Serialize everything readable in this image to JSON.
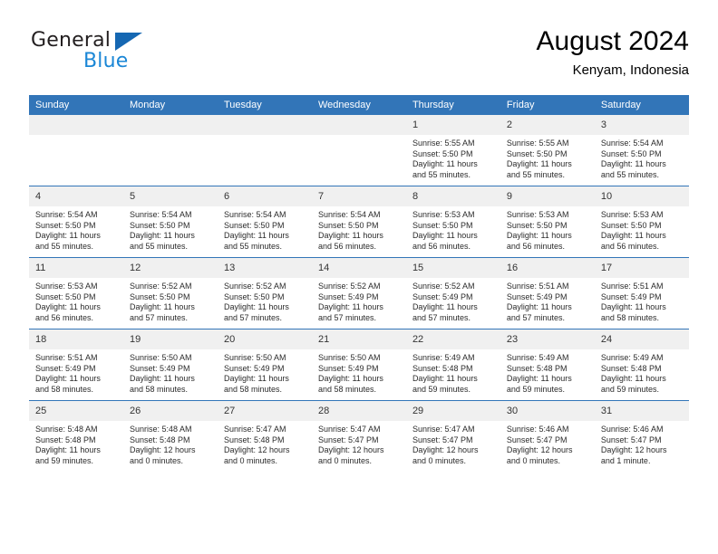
{
  "brand": {
    "word1": "General",
    "word2": "Blue",
    "triangle_color": "#1567b2",
    "blue_color": "#1b87d6"
  },
  "header": {
    "title": "August 2024",
    "subtitle": "Kenyam, Indonesia"
  },
  "theme": {
    "header_blue": "#3275b8",
    "daynum_band": "#f0f0f0"
  },
  "weekdays": [
    "Sunday",
    "Monday",
    "Tuesday",
    "Wednesday",
    "Thursday",
    "Friday",
    "Saturday"
  ],
  "weeks": [
    [
      {
        "day": "",
        "empty": true
      },
      {
        "day": "",
        "empty": true
      },
      {
        "day": "",
        "empty": true
      },
      {
        "day": "",
        "empty": true
      },
      {
        "day": "1",
        "sunrise": "Sunrise: 5:55 AM",
        "sunset": "Sunset: 5:50 PM",
        "daylight1": "Daylight: 11 hours",
        "daylight2": "and 55 minutes."
      },
      {
        "day": "2",
        "sunrise": "Sunrise: 5:55 AM",
        "sunset": "Sunset: 5:50 PM",
        "daylight1": "Daylight: 11 hours",
        "daylight2": "and 55 minutes."
      },
      {
        "day": "3",
        "sunrise": "Sunrise: 5:54 AM",
        "sunset": "Sunset: 5:50 PM",
        "daylight1": "Daylight: 11 hours",
        "daylight2": "and 55 minutes."
      }
    ],
    [
      {
        "day": "4",
        "sunrise": "Sunrise: 5:54 AM",
        "sunset": "Sunset: 5:50 PM",
        "daylight1": "Daylight: 11 hours",
        "daylight2": "and 55 minutes."
      },
      {
        "day": "5",
        "sunrise": "Sunrise: 5:54 AM",
        "sunset": "Sunset: 5:50 PM",
        "daylight1": "Daylight: 11 hours",
        "daylight2": "and 55 minutes."
      },
      {
        "day": "6",
        "sunrise": "Sunrise: 5:54 AM",
        "sunset": "Sunset: 5:50 PM",
        "daylight1": "Daylight: 11 hours",
        "daylight2": "and 55 minutes."
      },
      {
        "day": "7",
        "sunrise": "Sunrise: 5:54 AM",
        "sunset": "Sunset: 5:50 PM",
        "daylight1": "Daylight: 11 hours",
        "daylight2": "and 56 minutes."
      },
      {
        "day": "8",
        "sunrise": "Sunrise: 5:53 AM",
        "sunset": "Sunset: 5:50 PM",
        "daylight1": "Daylight: 11 hours",
        "daylight2": "and 56 minutes."
      },
      {
        "day": "9",
        "sunrise": "Sunrise: 5:53 AM",
        "sunset": "Sunset: 5:50 PM",
        "daylight1": "Daylight: 11 hours",
        "daylight2": "and 56 minutes."
      },
      {
        "day": "10",
        "sunrise": "Sunrise: 5:53 AM",
        "sunset": "Sunset: 5:50 PM",
        "daylight1": "Daylight: 11 hours",
        "daylight2": "and 56 minutes."
      }
    ],
    [
      {
        "day": "11",
        "sunrise": "Sunrise: 5:53 AM",
        "sunset": "Sunset: 5:50 PM",
        "daylight1": "Daylight: 11 hours",
        "daylight2": "and 56 minutes."
      },
      {
        "day": "12",
        "sunrise": "Sunrise: 5:52 AM",
        "sunset": "Sunset: 5:50 PM",
        "daylight1": "Daylight: 11 hours",
        "daylight2": "and 57 minutes."
      },
      {
        "day": "13",
        "sunrise": "Sunrise: 5:52 AM",
        "sunset": "Sunset: 5:50 PM",
        "daylight1": "Daylight: 11 hours",
        "daylight2": "and 57 minutes."
      },
      {
        "day": "14",
        "sunrise": "Sunrise: 5:52 AM",
        "sunset": "Sunset: 5:49 PM",
        "daylight1": "Daylight: 11 hours",
        "daylight2": "and 57 minutes."
      },
      {
        "day": "15",
        "sunrise": "Sunrise: 5:52 AM",
        "sunset": "Sunset: 5:49 PM",
        "daylight1": "Daylight: 11 hours",
        "daylight2": "and 57 minutes."
      },
      {
        "day": "16",
        "sunrise": "Sunrise: 5:51 AM",
        "sunset": "Sunset: 5:49 PM",
        "daylight1": "Daylight: 11 hours",
        "daylight2": "and 57 minutes."
      },
      {
        "day": "17",
        "sunrise": "Sunrise: 5:51 AM",
        "sunset": "Sunset: 5:49 PM",
        "daylight1": "Daylight: 11 hours",
        "daylight2": "and 58 minutes."
      }
    ],
    [
      {
        "day": "18",
        "sunrise": "Sunrise: 5:51 AM",
        "sunset": "Sunset: 5:49 PM",
        "daylight1": "Daylight: 11 hours",
        "daylight2": "and 58 minutes."
      },
      {
        "day": "19",
        "sunrise": "Sunrise: 5:50 AM",
        "sunset": "Sunset: 5:49 PM",
        "daylight1": "Daylight: 11 hours",
        "daylight2": "and 58 minutes."
      },
      {
        "day": "20",
        "sunrise": "Sunrise: 5:50 AM",
        "sunset": "Sunset: 5:49 PM",
        "daylight1": "Daylight: 11 hours",
        "daylight2": "and 58 minutes."
      },
      {
        "day": "21",
        "sunrise": "Sunrise: 5:50 AM",
        "sunset": "Sunset: 5:49 PM",
        "daylight1": "Daylight: 11 hours",
        "daylight2": "and 58 minutes."
      },
      {
        "day": "22",
        "sunrise": "Sunrise: 5:49 AM",
        "sunset": "Sunset: 5:48 PM",
        "daylight1": "Daylight: 11 hours",
        "daylight2": "and 59 minutes."
      },
      {
        "day": "23",
        "sunrise": "Sunrise: 5:49 AM",
        "sunset": "Sunset: 5:48 PM",
        "daylight1": "Daylight: 11 hours",
        "daylight2": "and 59 minutes."
      },
      {
        "day": "24",
        "sunrise": "Sunrise: 5:49 AM",
        "sunset": "Sunset: 5:48 PM",
        "daylight1": "Daylight: 11 hours",
        "daylight2": "and 59 minutes."
      }
    ],
    [
      {
        "day": "25",
        "sunrise": "Sunrise: 5:48 AM",
        "sunset": "Sunset: 5:48 PM",
        "daylight1": "Daylight: 11 hours",
        "daylight2": "and 59 minutes."
      },
      {
        "day": "26",
        "sunrise": "Sunrise: 5:48 AM",
        "sunset": "Sunset: 5:48 PM",
        "daylight1": "Daylight: 12 hours",
        "daylight2": "and 0 minutes."
      },
      {
        "day": "27",
        "sunrise": "Sunrise: 5:47 AM",
        "sunset": "Sunset: 5:48 PM",
        "daylight1": "Daylight: 12 hours",
        "daylight2": "and 0 minutes."
      },
      {
        "day": "28",
        "sunrise": "Sunrise: 5:47 AM",
        "sunset": "Sunset: 5:47 PM",
        "daylight1": "Daylight: 12 hours",
        "daylight2": "and 0 minutes."
      },
      {
        "day": "29",
        "sunrise": "Sunrise: 5:47 AM",
        "sunset": "Sunset: 5:47 PM",
        "daylight1": "Daylight: 12 hours",
        "daylight2": "and 0 minutes."
      },
      {
        "day": "30",
        "sunrise": "Sunrise: 5:46 AM",
        "sunset": "Sunset: 5:47 PM",
        "daylight1": "Daylight: 12 hours",
        "daylight2": "and 0 minutes."
      },
      {
        "day": "31",
        "sunrise": "Sunrise: 5:46 AM",
        "sunset": "Sunset: 5:47 PM",
        "daylight1": "Daylight: 12 hours",
        "daylight2": "and 1 minute."
      }
    ]
  ]
}
